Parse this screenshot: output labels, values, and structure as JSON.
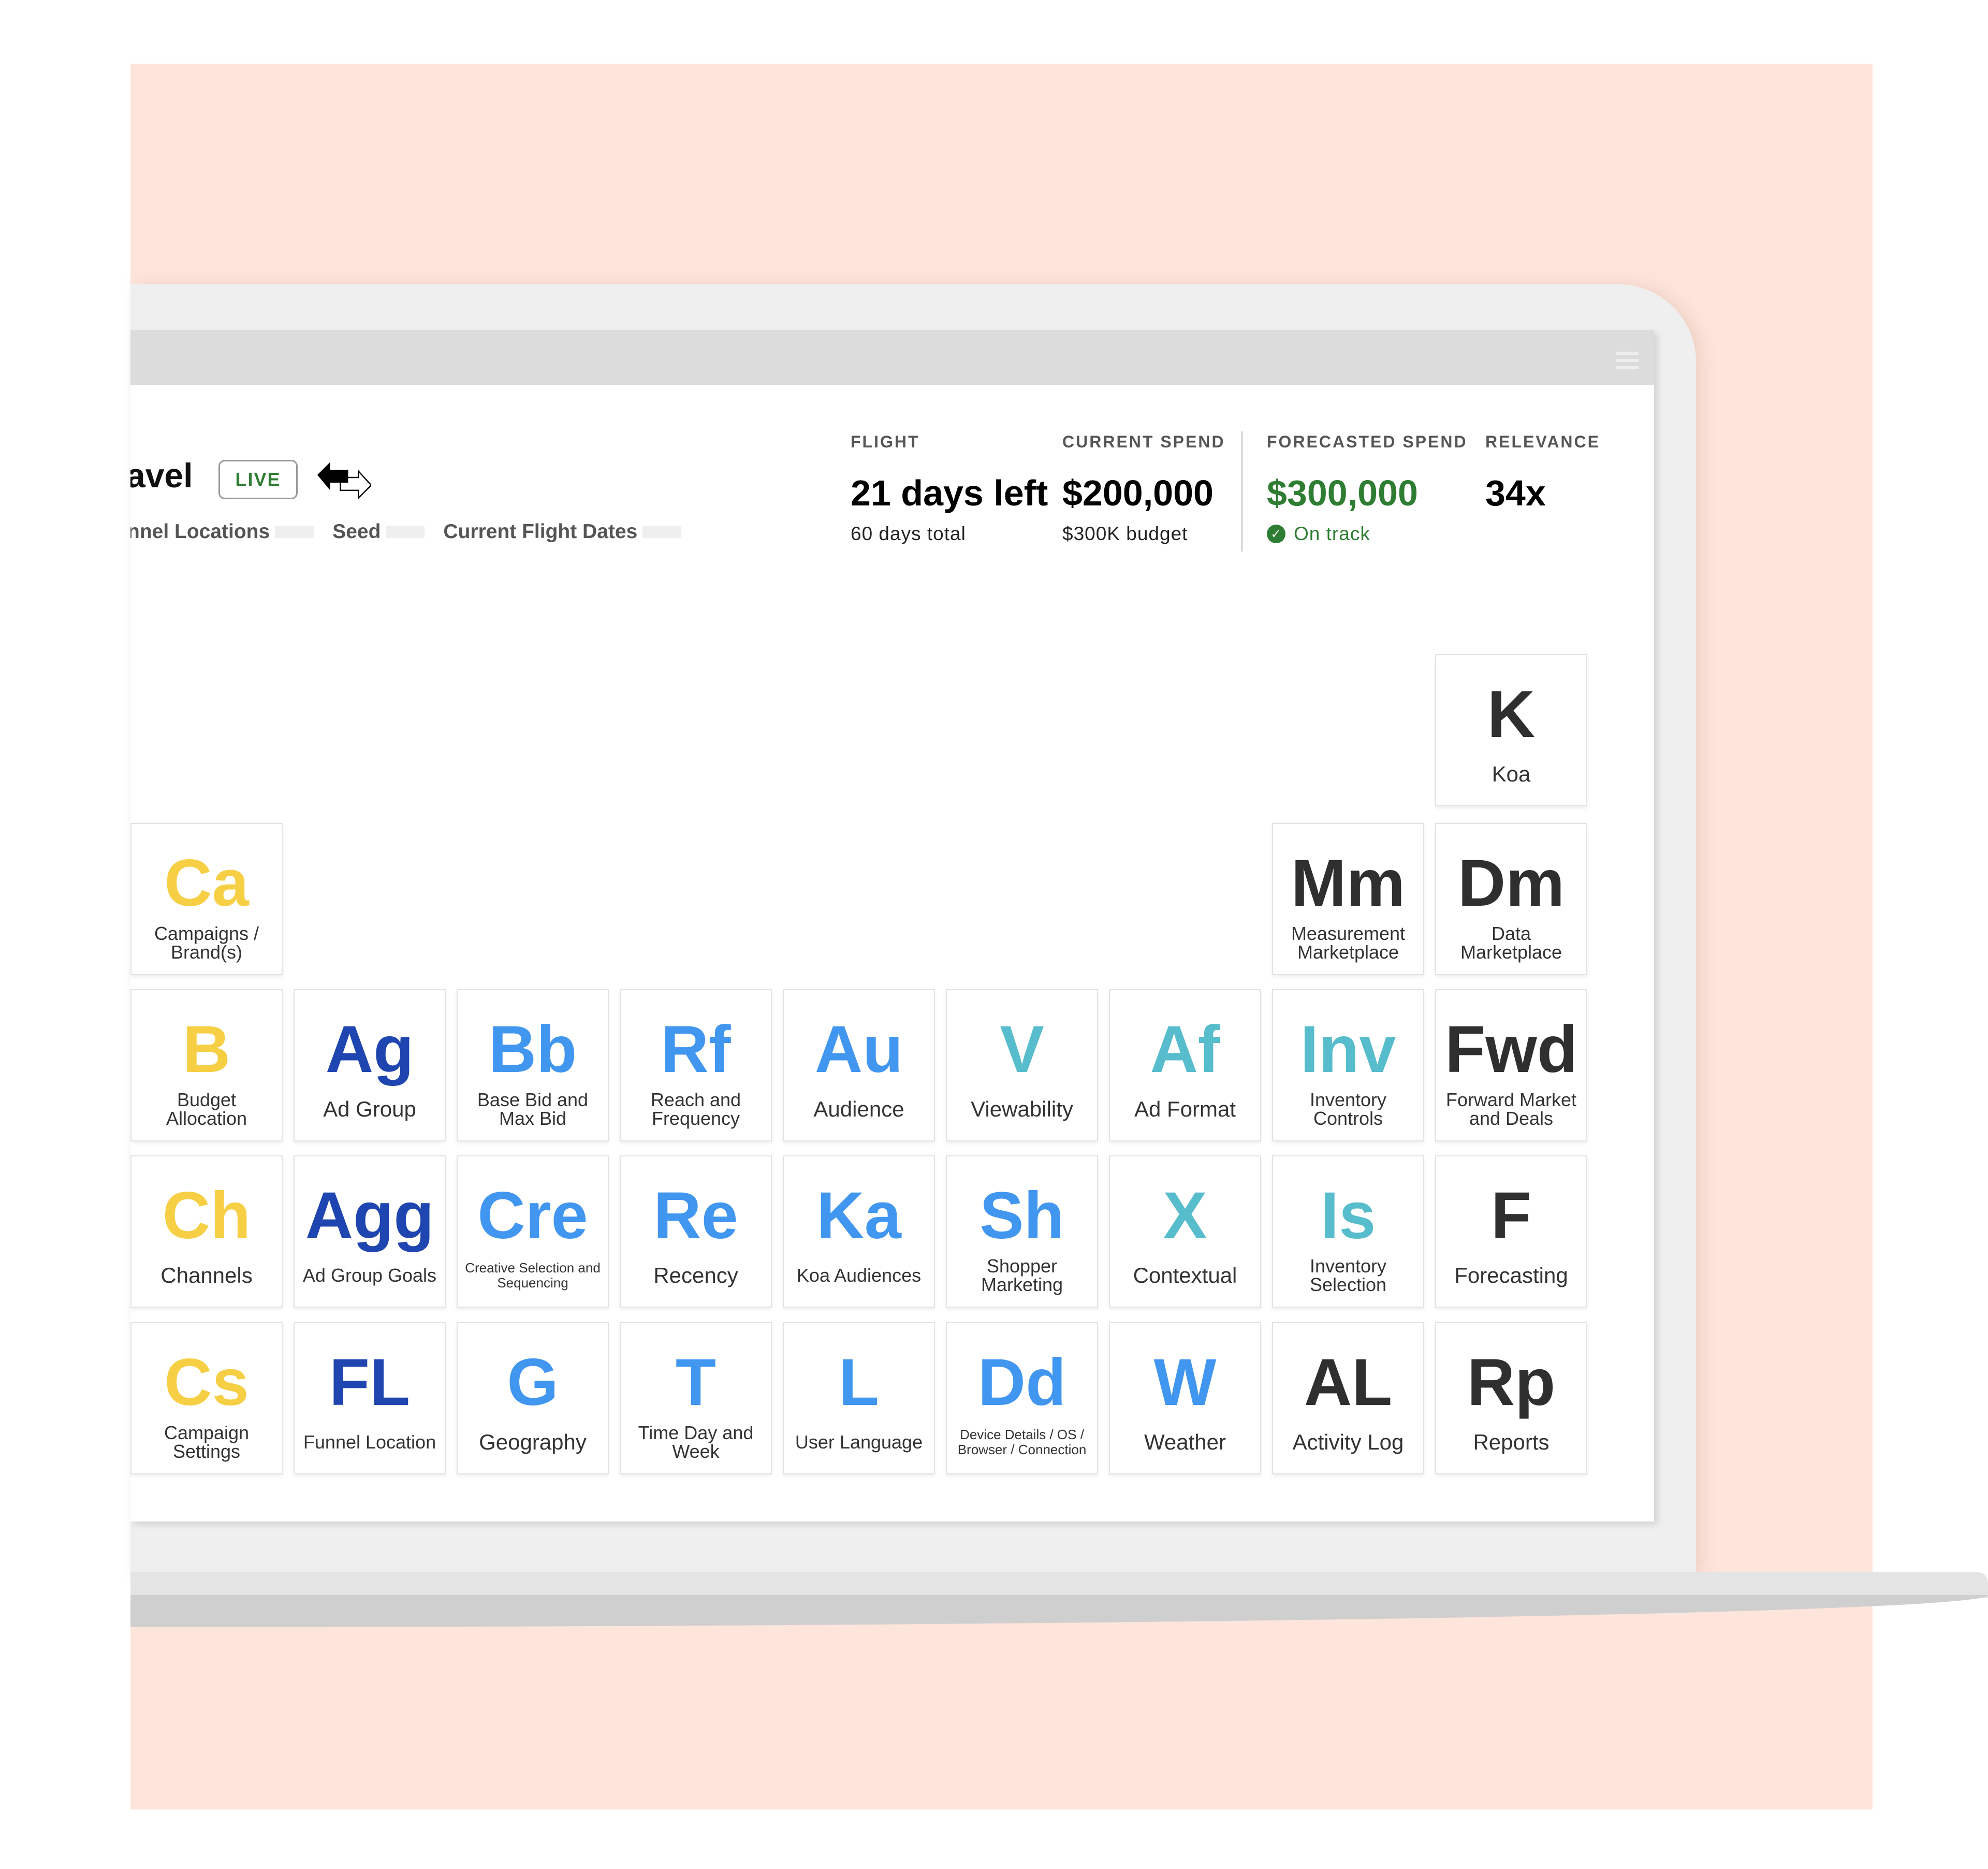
{
  "colors": {
    "yellow": "#f7cf45",
    "darkblue": "#1e45b0",
    "blue": "#4196f0",
    "teal": "#57bccb",
    "dark": "#2f2f2f",
    "peach": "#fde5dc",
    "green": "#2e7d32"
  },
  "header": {
    "title": "avel",
    "status_badge": "LIVE",
    "swap_icon": "swap-arrows-icon",
    "menu_icon": "hamburger-icon",
    "filters": [
      {
        "label": "nnel Locations"
      },
      {
        "label": "Seed"
      },
      {
        "label": "Current Flight Dates"
      }
    ]
  },
  "stats": [
    {
      "label": "FLIGHT",
      "value": "21 days left",
      "sub": "60 days total"
    },
    {
      "label": "CURRENT SPEND",
      "value": "$200,000",
      "sub": "$300K budget"
    },
    {
      "label": "FORECASTED SPEND",
      "value": "$300,000",
      "sub": "On track",
      "status_icon": "check-circle-icon"
    },
    {
      "label": "RELEVANCE",
      "value": "34x",
      "sub": ""
    }
  ],
  "grid": [
    [
      null,
      null,
      null,
      null,
      null,
      null,
      null,
      null,
      {
        "symbol": "K",
        "label": "Koa",
        "color": "dark"
      }
    ],
    [
      {
        "symbol": "Ca",
        "label": "Campaigns / Brand(s)",
        "color": "yellow"
      },
      null,
      null,
      null,
      null,
      null,
      null,
      {
        "symbol": "Mm",
        "label": "Measurement Marketplace",
        "color": "dark"
      },
      {
        "symbol": "Dm",
        "label": "Data Marketplace",
        "color": "dark"
      }
    ],
    [
      {
        "symbol": "B",
        "label": "Budget Allocation",
        "color": "yellow"
      },
      {
        "symbol": "Ag",
        "label": "Ad Group",
        "color": "darkblue"
      },
      {
        "symbol": "Bb",
        "label": "Base Bid and Max Bid",
        "color": "blue"
      },
      {
        "symbol": "Rf",
        "label": "Reach and Frequency",
        "color": "blue"
      },
      {
        "symbol": "Au",
        "label": "Audience",
        "color": "blue"
      },
      {
        "symbol": "V",
        "label": "Viewability",
        "color": "teal"
      },
      {
        "symbol": "Af",
        "label": "Ad Format",
        "color": "teal"
      },
      {
        "symbol": "Inv",
        "label": "Inventory Controls",
        "color": "teal"
      },
      {
        "symbol": "Fwd",
        "label": "Forward Market and Deals",
        "color": "dark"
      }
    ],
    [
      {
        "symbol": "Ch",
        "label": "Channels",
        "color": "yellow"
      },
      {
        "symbol": "Agg",
        "label": "Ad Group Goals",
        "color": "darkblue"
      },
      {
        "symbol": "Cre",
        "label": "Creative Selection and Sequencing",
        "color": "blue"
      },
      {
        "symbol": "Re",
        "label": "Recency",
        "color": "blue"
      },
      {
        "symbol": "Ka",
        "label": "Koa Audiences",
        "color": "blue"
      },
      {
        "symbol": "Sh",
        "label": "Shopper Marketing",
        "color": "blue"
      },
      {
        "symbol": "X",
        "label": "Contextual",
        "color": "teal"
      },
      {
        "symbol": "Is",
        "label": "Inventory Selection",
        "color": "teal"
      },
      {
        "symbol": "F",
        "label": "Forecasting",
        "color": "dark"
      }
    ],
    [
      {
        "symbol": "Cs",
        "label": "Campaign Settings",
        "color": "yellow"
      },
      {
        "symbol": "FL",
        "label": "Funnel Location",
        "color": "darkblue"
      },
      {
        "symbol": "G",
        "label": "Geography",
        "color": "blue"
      },
      {
        "symbol": "T",
        "label": "Time Day and Week",
        "color": "blue"
      },
      {
        "symbol": "L",
        "label": "User Language",
        "color": "blue"
      },
      {
        "symbol": "Dd",
        "label": "Device Details / OS / Browser / Connection",
        "color": "blue"
      },
      {
        "symbol": "W",
        "label": "Weather",
        "color": "blue"
      },
      {
        "symbol": "AL",
        "label": "Activity Log",
        "color": "dark"
      },
      {
        "symbol": "Rp",
        "label": "Reports",
        "color": "dark"
      }
    ]
  ]
}
